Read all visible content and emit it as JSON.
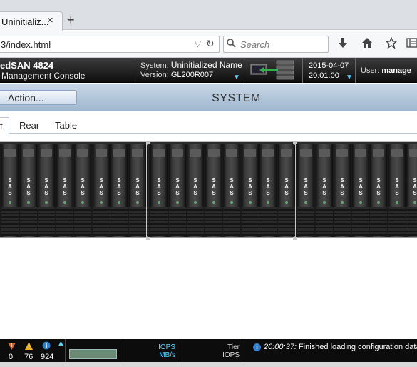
{
  "browser": {
    "tab_title": "Uninitializ...",
    "tab_close": "×",
    "new_tab": "+",
    "url": "3/index.html",
    "search_placeholder": "Search"
  },
  "header": {
    "product_name": "edSAN 4824",
    "product_subtitle": "Management Console",
    "system_label": "System:",
    "system_name": "Uninitialized Name",
    "version_label": "Version:",
    "version": "GL200R007",
    "date": "2015-04-07",
    "time": "20:01:00",
    "user_label": "User:",
    "user_name": "manage"
  },
  "actionbar": {
    "action_label": "Action...",
    "title": "SYSTEM"
  },
  "view_tabs": [
    {
      "label": "t",
      "active": true
    },
    {
      "label": "Rear",
      "active": false
    },
    {
      "label": "Table",
      "active": false
    }
  ],
  "enclosure": {
    "drive_label": "SAS",
    "drive_count_visible": 24
  },
  "statusbar": {
    "critical_count": "0",
    "warning_count": "76",
    "info_count": "924",
    "iops_label": "IOPS",
    "mbs_label": "MB/s",
    "tier_label": "Tier",
    "tier_iops_label": "IOPS",
    "message_time": "20:00:37:",
    "message_text": "Finished loading configuration data."
  }
}
